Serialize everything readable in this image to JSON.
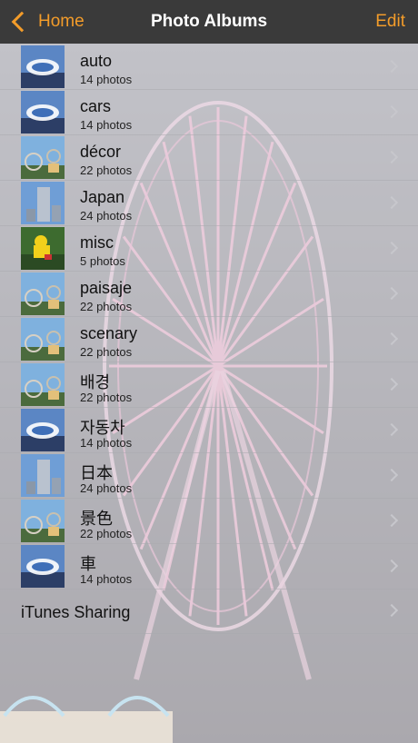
{
  "nav": {
    "back_label": "Home",
    "title": "Photo Albums",
    "edit_label": "Edit"
  },
  "albums": [
    {
      "name": "auto",
      "count": "14 photos",
      "thumb": "stadium"
    },
    {
      "name": "cars",
      "count": "14 photos",
      "thumb": "stadium"
    },
    {
      "name": "décor",
      "count": "22 photos",
      "thumb": "ferris-wheel"
    },
    {
      "name": "Japan",
      "count": "24 photos",
      "thumb": "tower"
    },
    {
      "name": "misc",
      "count": "5 photos",
      "thumb": "yellow-figure"
    },
    {
      "name": "paisaje",
      "count": "22 photos",
      "thumb": "ferris-wheel"
    },
    {
      "name": "scenary",
      "count": "22 photos",
      "thumb": "ferris-wheel"
    },
    {
      "name": "배경",
      "count": "22 photos",
      "thumb": "ferris-wheel"
    },
    {
      "name": "자동차",
      "count": "14 photos",
      "thumb": "stadium"
    },
    {
      "name": "日本",
      "count": "24 photos",
      "thumb": "tower"
    },
    {
      "name": "景色",
      "count": "22 photos",
      "thumb": "ferris-wheel"
    },
    {
      "name": "車",
      "count": "14 photos",
      "thumb": "stadium"
    }
  ],
  "itunes_sharing": {
    "label": "iTunes Sharing"
  },
  "colors": {
    "accent": "#f39c2a",
    "navbar": "#3a3a3a",
    "separator": "#c7c7cc"
  }
}
